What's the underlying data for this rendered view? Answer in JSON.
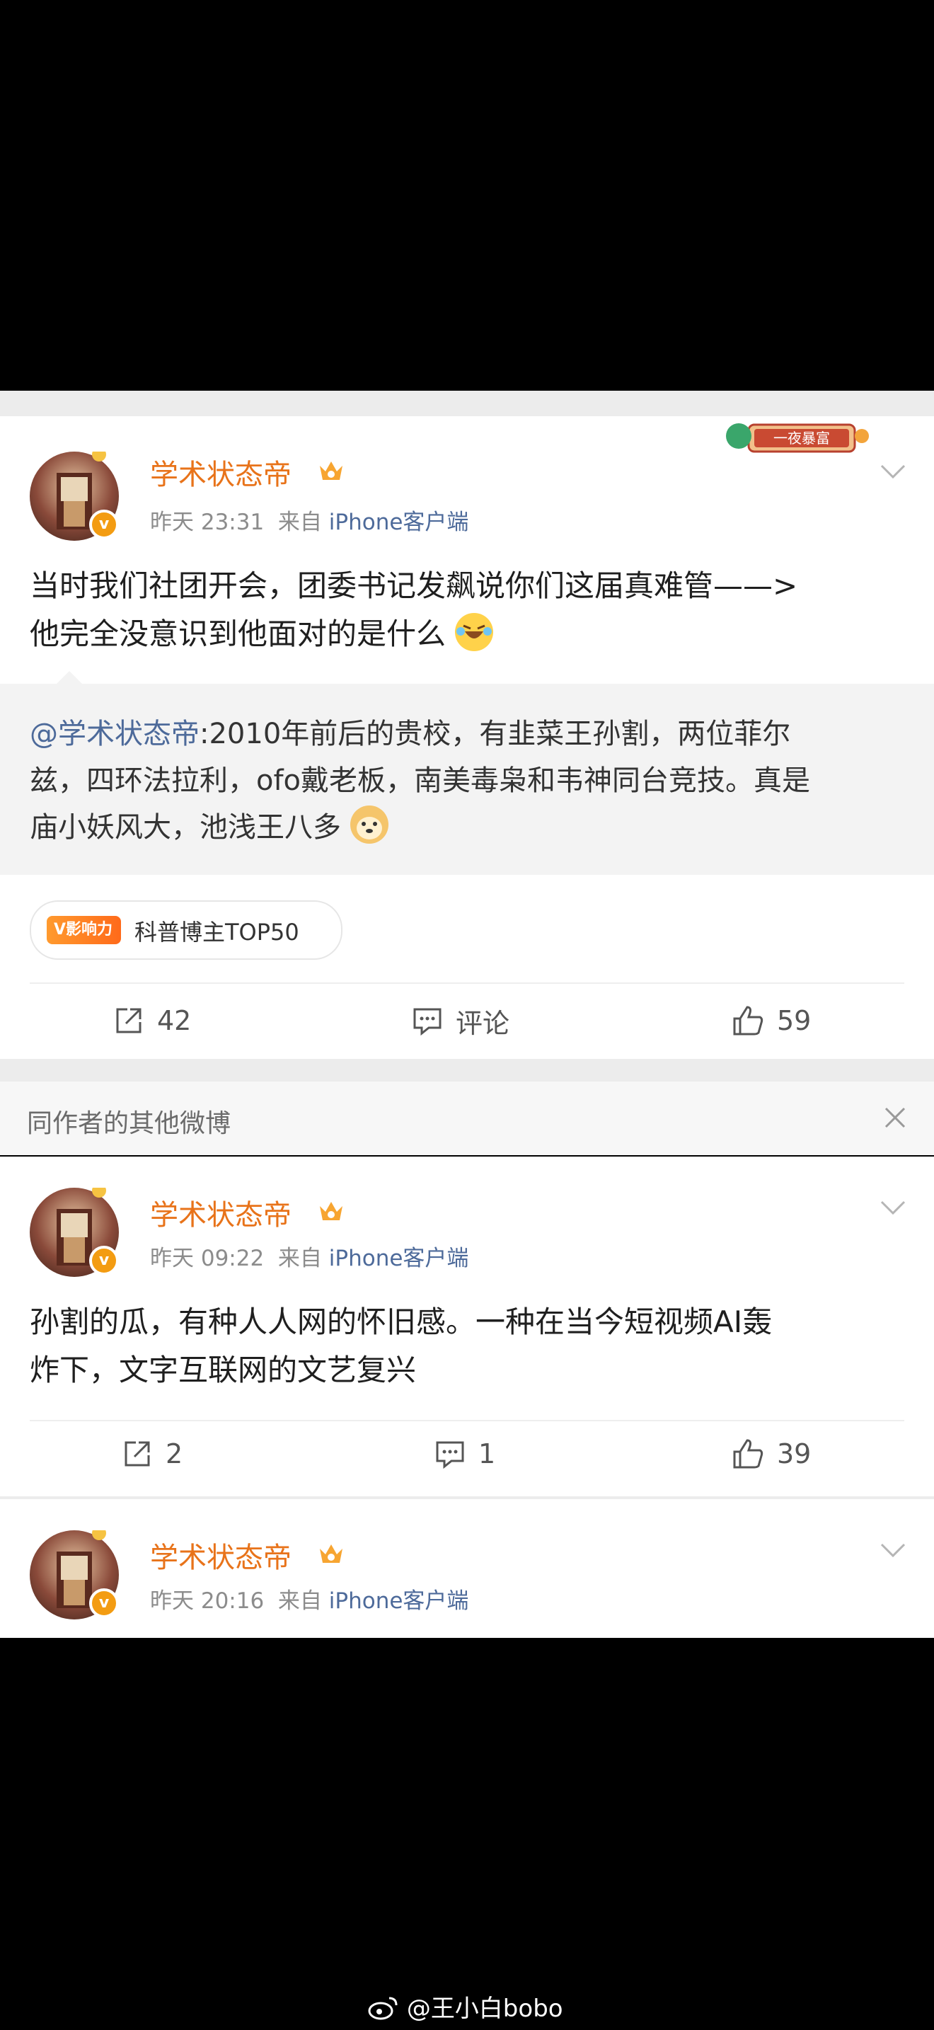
{
  "post1": {
    "user": "学术状态帝",
    "time": "昨天 23:31",
    "from_prefix": "来自",
    "source": "iPhone客户端",
    "badge_banner": "一夜暴富",
    "text_line1": "当时我们社团开会，团委书记发飙说你们这届真难管——>",
    "text_line2": "他完全没意识到他面对的是什么",
    "quote_mention": "@学术状态帝",
    "quote_text1": ":2010年前后的贵校，有韭菜王孙割，两位菲尔",
    "quote_text2": "兹，四环法拉利，ofo戴老板，南美毒枭和韦神同台竞技。真是",
    "quote_text3": "庙小妖风大，池浅王八多",
    "influence_tag": "V影响力",
    "influence_label": "科普博主TOP50",
    "repost_count": "42",
    "comment_label": "评论",
    "like_count": "59"
  },
  "section": {
    "title": "同作者的其他微博"
  },
  "post2": {
    "user": "学术状态帝",
    "time": "昨天 09:22",
    "from_prefix": "来自",
    "source": "iPhone客户端",
    "text_line1": "孙割的瓜，有种人人网的怀旧感。一种在当今短视频AI轰",
    "text_line2": "炸下，文字互联网的文艺复兴",
    "repost_count": "2",
    "comment_count": "1",
    "like_count": "39"
  },
  "post3": {
    "user": "学术状态帝",
    "time": "昨天 20:16",
    "from_prefix": "来自",
    "source": "iPhone客户端"
  },
  "watermark": "@王小白bobo",
  "colors": {
    "username": "#e8731a",
    "link": "#4d6a9a",
    "badge": "#f39c12"
  }
}
